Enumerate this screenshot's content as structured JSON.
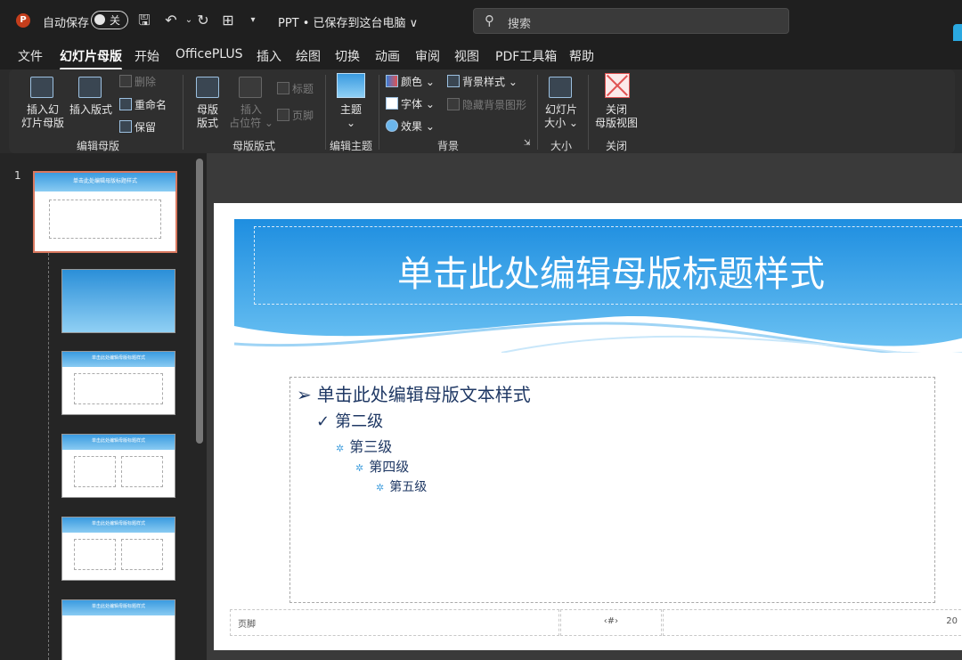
{
  "titlebar": {
    "app_icon": "P",
    "autosave_label": "自动保存",
    "autosave_state": "关",
    "doc_title": "PPT • 已保存到这台电脑 ∨",
    "search_placeholder": "搜索"
  },
  "tabs": [
    "文件",
    "幻灯片母版",
    "开始",
    "OfficePLUS",
    "插入",
    "绘图",
    "切换",
    "动画",
    "审阅",
    "视图",
    "PDF工具箱",
    "帮助"
  ],
  "ribbon": {
    "insert_slide_master": [
      "插入幻",
      "灯片母版"
    ],
    "insert_layout": "插入版式",
    "delete": "删除",
    "rename": "重命名",
    "preserve": "保留",
    "group_edit_master": "编辑母版",
    "master_layout": [
      "母版",
      "版式"
    ],
    "insert_placeholder": [
      "插入",
      "占位符 ⌄"
    ],
    "title_check": "标题",
    "footer_check": "页脚",
    "group_master_layout": "母版版式",
    "themes": [
      "主题",
      "⌄"
    ],
    "group_edit_theme": "编辑主题",
    "colors": "颜色 ⌄",
    "fonts": "字体 ⌄",
    "effects": "效果 ⌄",
    "background_styles": "背景样式 ⌄",
    "hide_bg_graphics": "隐藏背景图形",
    "group_background": "背景",
    "slide_size": [
      "幻灯片",
      "大小 ⌄"
    ],
    "group_size": "大小",
    "close_master": [
      "关闭",
      "母版视图"
    ],
    "group_close": "关闭"
  },
  "thumbnails": {
    "slide_number": "1",
    "main_title": "单击此处编辑母版标题样式",
    "layout_title": "单击此处编辑母版标题样式"
  },
  "slide": {
    "title": "单击此处编辑母版标题样式",
    "levels": [
      {
        "bullet": "➢",
        "text": "单击此处编辑母版文本样式"
      },
      {
        "bullet": "✓",
        "text": "第二级"
      },
      {
        "bullet": "✲",
        "text": "第三级"
      },
      {
        "bullet": "✲",
        "text": "第四级"
      },
      {
        "bullet": "✲",
        "text": "第五级"
      }
    ],
    "footer_text": "页脚",
    "page_marker": "‹#›",
    "date_text": "20"
  }
}
